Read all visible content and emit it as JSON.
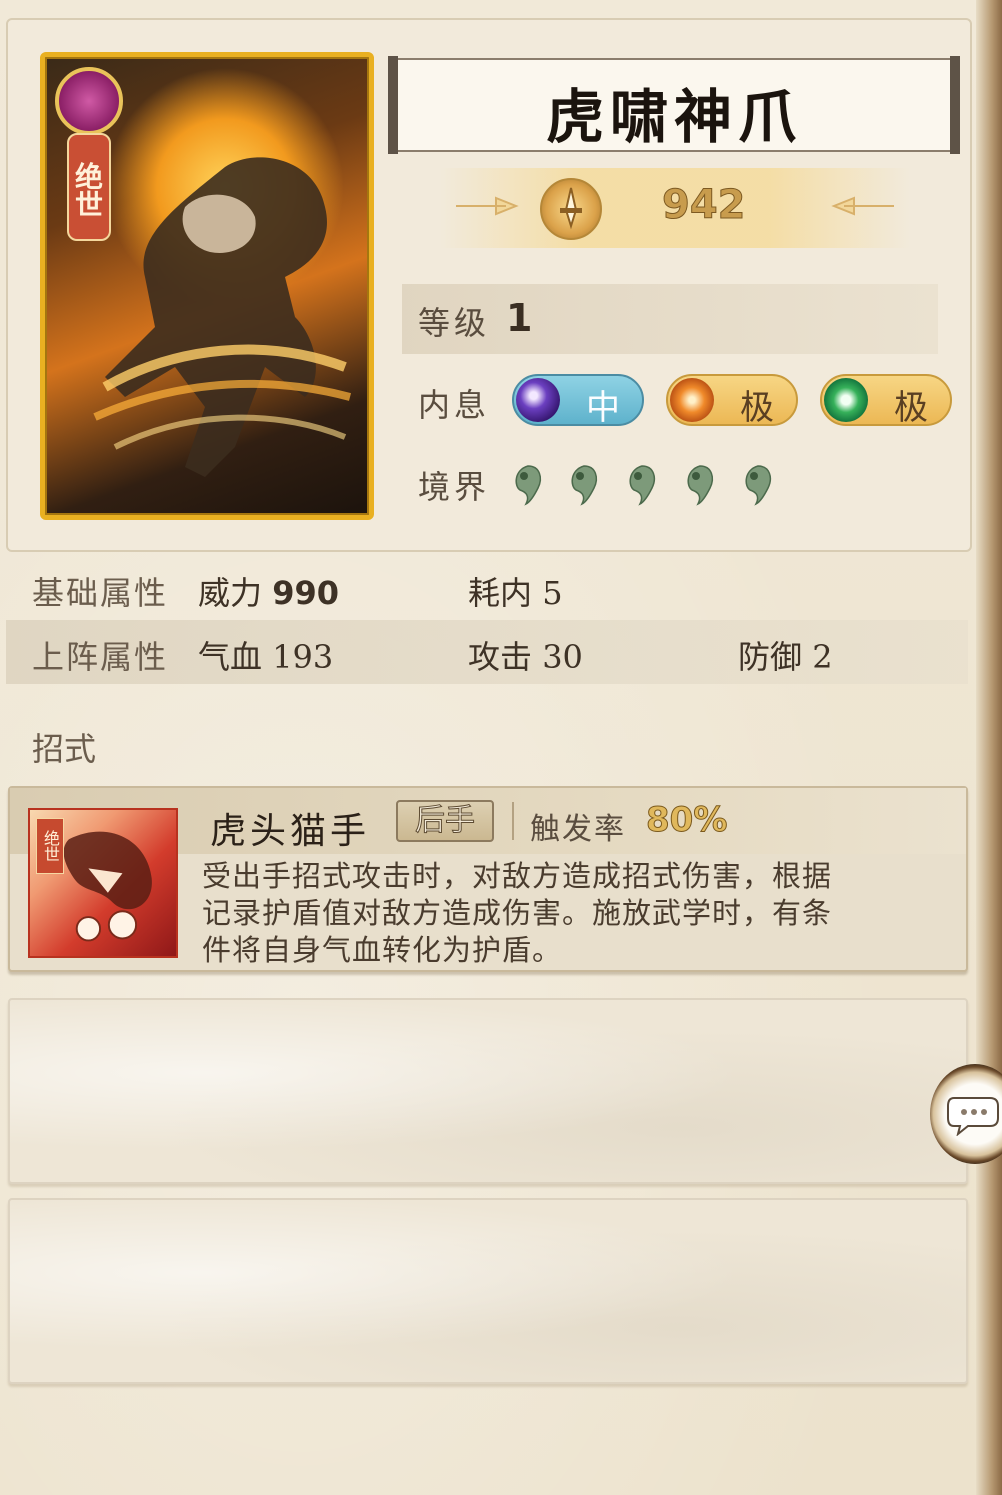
{
  "skill": {
    "name": "虎啸神爪",
    "power": "942",
    "card_tier": "绝世"
  },
  "level": {
    "label": "等级",
    "value": "1"
  },
  "inner_breath": {
    "label": "内息",
    "slots": [
      {
        "icon": "purple-moon-orb-icon",
        "grade": "中"
      },
      {
        "icon": "orange-sun-orb-icon",
        "grade": "极"
      },
      {
        "icon": "green-ring-orb-icon",
        "grade": "极"
      }
    ]
  },
  "realm": {
    "label": "境界",
    "stages": 5,
    "icon": "jade-drop-icon",
    "color": "#7d9a7a"
  },
  "base_attributes": {
    "label": "基础属性",
    "items": [
      {
        "name": "威力",
        "value": "990"
      },
      {
        "name": "耗内",
        "value": "5"
      }
    ]
  },
  "battle_attributes": {
    "label": "上阵属性",
    "items": [
      {
        "name": "气血",
        "value": "193"
      },
      {
        "name": "攻击",
        "value": "30"
      },
      {
        "name": "防御",
        "value": "2"
      }
    ]
  },
  "moves": {
    "section_label": "招式",
    "list": [
      {
        "name": "虎头猫手",
        "type": "后手",
        "trigger_label": "触发率",
        "trigger_rate": "80%",
        "icon_tag": "绝世",
        "description": "受出手招式攻击时，对敌方造成招式伤害，根据记录护盾值对敌方造成伤害。施放武学时，有条件将自身气血转化为护盾。"
      }
    ]
  },
  "colors": {
    "card_border": "#e9b021",
    "accent_gold": "#c89c4d",
    "background": "#efe6d3"
  }
}
